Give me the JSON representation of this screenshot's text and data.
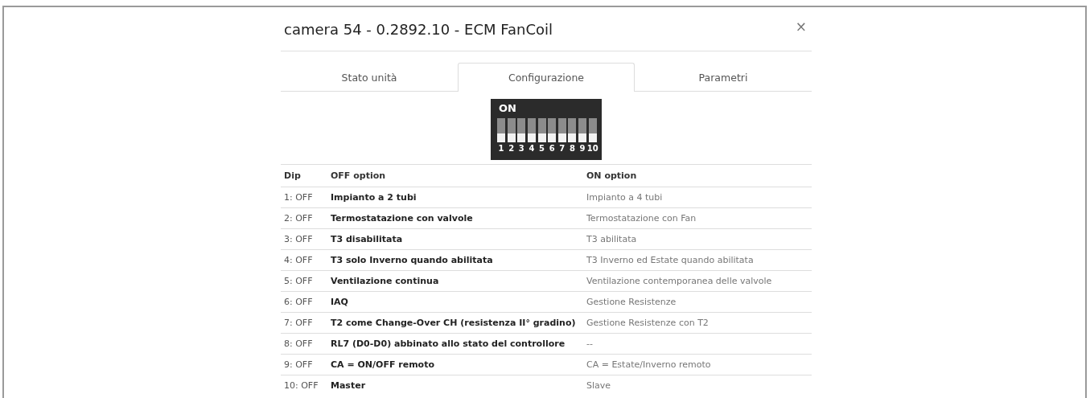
{
  "dialog": {
    "title": "camera 54 - 0.2892.10 - ECM FanCoil",
    "close": "×"
  },
  "tabs": [
    {
      "label": "Stato unità",
      "selected": false
    },
    {
      "label": "Configurazione",
      "selected": true
    },
    {
      "label": "Parametri",
      "selected": false
    }
  ],
  "dip_switch": {
    "label": "ON",
    "switches": [
      {
        "number": "1",
        "on": false
      },
      {
        "number": "2",
        "on": false
      },
      {
        "number": "3",
        "on": false
      },
      {
        "number": "4",
        "on": false
      },
      {
        "number": "5",
        "on": false
      },
      {
        "number": "6",
        "on": false
      },
      {
        "number": "7",
        "on": false
      },
      {
        "number": "8",
        "on": false
      },
      {
        "number": "9",
        "on": false
      },
      {
        "number": "10",
        "on": false
      }
    ]
  },
  "table": {
    "columns": [
      "Dip",
      "OFF option",
      "ON option"
    ],
    "rows": [
      {
        "dip": "1: OFF",
        "off_option": "Impianto a 2 tubi",
        "on_option": "Impianto a 4 tubi"
      },
      {
        "dip": "2: OFF",
        "off_option": "Termostatazione con valvole",
        "on_option": "Termostatazione con Fan"
      },
      {
        "dip": "3: OFF",
        "off_option": "T3 disabilitata",
        "on_option": "T3 abilitata"
      },
      {
        "dip": "4: OFF",
        "off_option": "T3 solo Inverno quando abilitata",
        "on_option": "T3 Inverno ed Estate quando abilitata"
      },
      {
        "dip": "5: OFF",
        "off_option": "Ventilazione continua",
        "on_option": "Ventilazione contemporanea delle valvole"
      },
      {
        "dip": "6: OFF",
        "off_option": "IAQ",
        "on_option": "Gestione Resistenze"
      },
      {
        "dip": "7: OFF",
        "off_option": "T2 come Change-Over CH (resistenza II° gradino)",
        "on_option": "Gestione Resistenze con T2"
      },
      {
        "dip": "8: OFF",
        "off_option": "RL7 (D0-D0) abbinato allo stato del controllore",
        "on_option": "--"
      },
      {
        "dip": "9: OFF",
        "off_option": "CA = ON/OFF remoto",
        "on_option": "CA = Estate/Inverno remoto"
      },
      {
        "dip": "10: OFF",
        "off_option": "Master",
        "on_option": "Slave"
      }
    ]
  }
}
